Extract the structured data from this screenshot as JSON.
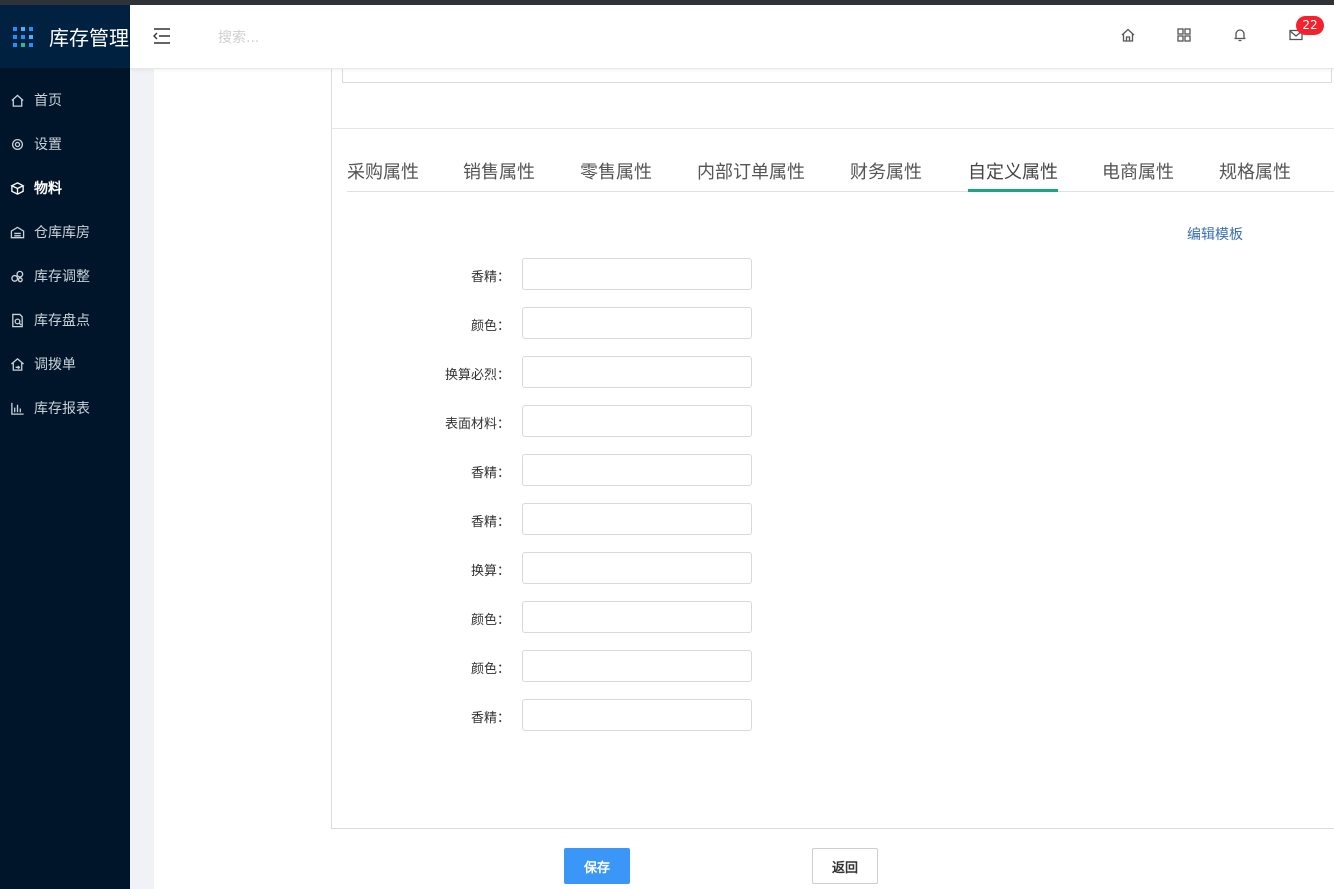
{
  "app": {
    "title": "库存管理"
  },
  "sidebar": {
    "items": [
      {
        "label": "首页",
        "icon": "home-icon",
        "active": false
      },
      {
        "label": "设置",
        "icon": "gear-icon",
        "active": false
      },
      {
        "label": "物料",
        "icon": "box-icon",
        "active": true
      },
      {
        "label": "仓库库房",
        "icon": "warehouse-icon",
        "active": false
      },
      {
        "label": "库存调整",
        "icon": "adjust-icon",
        "active": false
      },
      {
        "label": "库存盘点",
        "icon": "inventory-check-icon",
        "active": false
      },
      {
        "label": "调拨单",
        "icon": "transfer-icon",
        "active": false
      },
      {
        "label": "库存报表",
        "icon": "bar-chart-icon",
        "active": false
      }
    ]
  },
  "header": {
    "search_placeholder": "搜索...",
    "icons": [
      "home-icon",
      "apps-grid-icon",
      "bell-icon",
      "mail-icon"
    ],
    "mail_badge": "22"
  },
  "tabs": [
    {
      "label": "采购属性",
      "active": false
    },
    {
      "label": "销售属性",
      "active": false
    },
    {
      "label": "零售属性",
      "active": false
    },
    {
      "label": "内部订单属性",
      "active": false
    },
    {
      "label": "财务属性",
      "active": false
    },
    {
      "label": "自定义属性",
      "active": true
    },
    {
      "label": "电商属性",
      "active": false
    },
    {
      "label": "规格属性",
      "active": false
    }
  ],
  "edit_template_link": "编辑模板",
  "form": {
    "fields": [
      {
        "label": "香精：",
        "value": ""
      },
      {
        "label": "颜色：",
        "value": ""
      },
      {
        "label": "换算必烈：",
        "value": ""
      },
      {
        "label": "表面材料：",
        "value": ""
      },
      {
        "label": "香精：",
        "value": ""
      },
      {
        "label": "香精：",
        "value": ""
      },
      {
        "label": "换算：",
        "value": ""
      },
      {
        "label": "颜色：",
        "value": ""
      },
      {
        "label": "颜色：",
        "value": ""
      },
      {
        "label": "香精：",
        "value": ""
      }
    ]
  },
  "footer": {
    "save_label": "保存",
    "back_label": "返回"
  },
  "colors": {
    "sidebar_bg": "#001529",
    "accent_tab": "#1aa583",
    "primary_button": "#3a97f8",
    "badge": "#f5222d",
    "link": "#3a6fb0"
  }
}
